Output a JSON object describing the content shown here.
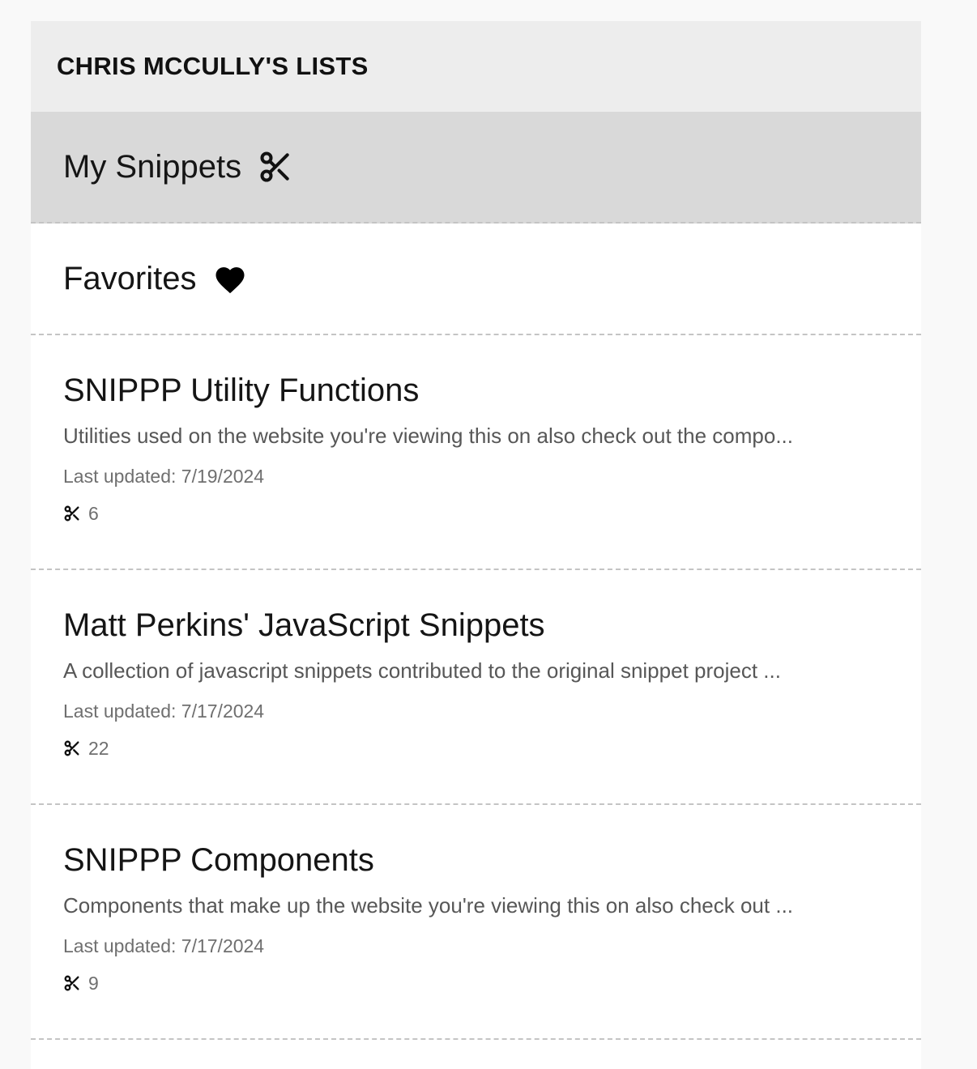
{
  "header": {
    "title": "CHRIS MCCULLY'S LISTS"
  },
  "nav": [
    {
      "label": "My Snippets",
      "icon": "scissors-icon",
      "active": true
    },
    {
      "label": "Favorites",
      "icon": "heart-icon",
      "active": false
    }
  ],
  "lists": [
    {
      "title": "SNIPPP Utility Functions",
      "description": "Utilities used on the website you're viewing this on also check out the compo...",
      "updated": "Last updated: 7/19/2024",
      "count": "6",
      "count_icon": "scissors-icon"
    },
    {
      "title": "Matt Perkins' JavaScript Snippets",
      "description": "A collection of javascript snippets contributed to the original snippet project ...",
      "updated": "Last updated: 7/17/2024",
      "count": "22",
      "count_icon": "scissors-icon"
    },
    {
      "title": "SNIPPP Components",
      "description": "Components that make up the website you're viewing this on also check out ...",
      "updated": "Last updated: 7/17/2024",
      "count": "9",
      "count_icon": "scissors-icon"
    }
  ],
  "colors": {
    "header_bg": "#ededed",
    "active_bg": "#d9d9d9",
    "divider": "#c4c4c4"
  }
}
